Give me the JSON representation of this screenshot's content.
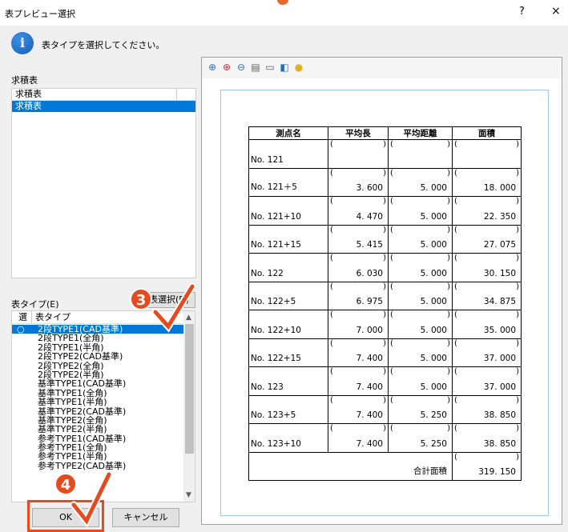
{
  "window": {
    "title": "表プレビュー選択",
    "help": "?",
    "close": "×"
  },
  "info": {
    "icon": "i",
    "message": "表タイプを選択してください。"
  },
  "list1": {
    "label": "求積表",
    "header": "求積表",
    "selected": "求積表"
  },
  "type": {
    "label": "表タイプ(E)",
    "select_button": "表選択(D)",
    "col_sel": "選",
    "col_type": "表タイプ",
    "items": [
      "2段TYPE1(CAD基準)",
      "2段TYPE1(全角)",
      "2段TYPE1(半角)",
      "2段TYPE2(CAD基準)",
      "2段TYPE2(全角)",
      "2段TYPE2(半角)",
      "基準TYPE1(CAD基準)",
      "基準TYPE1(全角)",
      "基準TYPE1(半角)",
      "基準TYPE2(CAD基準)",
      "基準TYPE2(全角)",
      "基準TYPE2(半角)",
      "参考TYPE1(CAD基準)",
      "参考TYPE1(全角)",
      "参考TYPE1(半角)",
      "参考TYPE2(CAD基準)"
    ],
    "selected_index": 0,
    "radio": "○"
  },
  "buttons": {
    "ok": "OK",
    "cancel": "キャンセル"
  },
  "markers": {
    "m3": "3",
    "m4": "4"
  },
  "table": {
    "headers": [
      "測点名",
      "平均長",
      "平均距離",
      "面積"
    ],
    "rows": [
      [
        "No. 121",
        "",
        "",
        ""
      ],
      [
        "No. 121＋5",
        "3. 600",
        "5. 000",
        "18. 000"
      ],
      [
        "No. 121+10",
        "4. 470",
        "5. 000",
        "22. 350"
      ],
      [
        "No. 121+15",
        "5. 415",
        "5. 000",
        "27. 075"
      ],
      [
        "No. 122",
        "6. 030",
        "5. 000",
        "30. 150"
      ],
      [
        "No. 122+5",
        "6. 975",
        "5. 000",
        "34. 875"
      ],
      [
        "No. 122+10",
        "7. 000",
        "5. 000",
        "35. 000"
      ],
      [
        "No. 122+15",
        "7. 400",
        "5. 000",
        "37. 000"
      ],
      [
        "No. 123",
        "7. 400",
        "5. 000",
        "37. 000"
      ],
      [
        "No. 123+5",
        "7. 400",
        "5. 250",
        "38. 850"
      ],
      [
        "No. 123+10",
        "7. 400",
        "5. 250",
        "38. 850"
      ]
    ],
    "total_label": "合計面積",
    "total_value": "319. 150",
    "paren_open": "(",
    "paren_close": ")"
  },
  "toolbar_icons": [
    "zoom-fit-icon",
    "zoom-in-icon",
    "zoom-out-icon",
    "print-icon",
    "page-icon",
    "export-icon",
    "tip-icon"
  ],
  "colors": {
    "selection": "#0078d7",
    "marker": "#e64b20"
  }
}
